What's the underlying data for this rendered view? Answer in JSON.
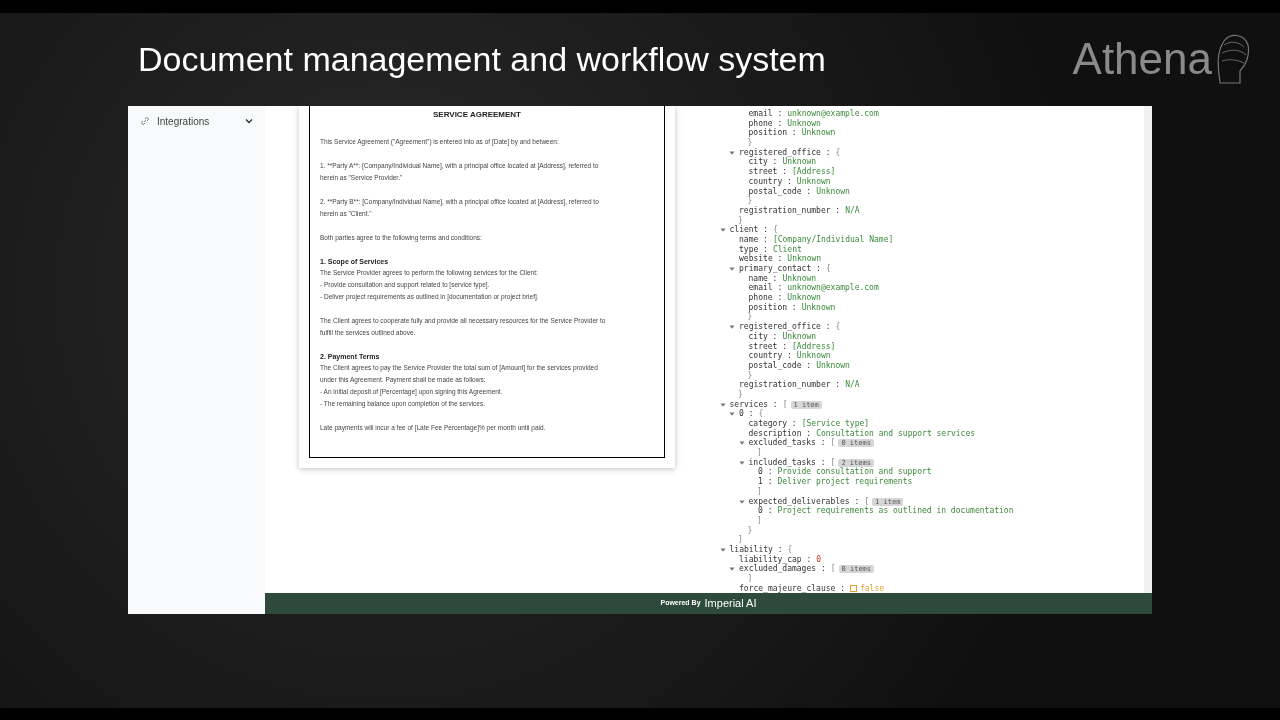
{
  "slide": {
    "title": "Document management and workflow system",
    "brand": "Athena"
  },
  "sidebar": {
    "items": [
      {
        "label": "Integrations",
        "expanded": false
      }
    ]
  },
  "document": {
    "title": "SERVICE AGREEMENT",
    "paragraphs": [
      {
        "lines": [
          "This Service Agreement (\"Agreement\") is entered into as of [Date] by and between:"
        ]
      },
      {
        "lines": [
          "1. **Party A**: [Company/Individual Name], with a principal office located at [Address], referred to",
          "herein as \"Service Provider.\""
        ]
      },
      {
        "lines": [
          "2. **Party B**: [Company/Individual Name], with a principal office located at [Address], referred to",
          "herein as \"Client.\""
        ]
      },
      {
        "lines": [
          "Both parties agree to the following terms and conditions:"
        ]
      },
      {
        "heading": "1. Scope of Services",
        "lines": [
          "The Service Provider agrees to perform the following services for the Client:",
          "- Provide consultation and support related to [service type].",
          "- Deliver project requirements as outlined in [documentation or project brief]."
        ]
      },
      {
        "lines": [
          "The Client agrees to cooperate fully and provide all necessary resources for the Service Provider to",
          "fulfill the services outlined above."
        ]
      },
      {
        "heading": "2. Payment Terms",
        "lines": [
          "The Client agrees to pay the Service Provider the total sum of [Amount] for the services provided",
          "under this Agreement. Payment shall be made as follows:",
          "- An initial deposit of [Percentage] upon signing this Agreement.",
          "- The remaining balance upon completion of the services."
        ]
      },
      {
        "lines": [
          "Late payments will incur a fee of [Late Fee Percentage]% per month until paid."
        ]
      }
    ]
  },
  "tree": [
    {
      "kind": "object",
      "close": "}",
      "children": [
        {
          "kind": "object",
          "close": "}",
          "children": [
            {
              "kind": "string",
              "key": "email :",
              "value": "unknown@example.com"
            },
            {
              "kind": "string",
              "key": "phone :",
              "value": "Unknown"
            },
            {
              "kind": "string",
              "key": "position :",
              "value": "Unknown"
            }
          ]
        },
        {
          "kind": "object",
          "key": "registered_office :",
          "open": "{",
          "close": "}",
          "expanded": true,
          "children": [
            {
              "kind": "string",
              "key": "city :",
              "value": "Unknown"
            },
            {
              "kind": "string",
              "key": "street :",
              "value": "[Address]"
            },
            {
              "kind": "string",
              "key": "country :",
              "value": "Unknown"
            },
            {
              "kind": "string",
              "key": "postal_code :",
              "value": "Unknown"
            }
          ]
        },
        {
          "kind": "string",
          "key": "registration_number :",
          "value": "N/A"
        }
      ]
    },
    {
      "kind": "object",
      "key": "client :",
      "open": "{",
      "close": "}",
      "expanded": true,
      "children": [
        {
          "kind": "string",
          "key": "name :",
          "value": "[Company/Individual Name]"
        },
        {
          "kind": "string",
          "key": "type :",
          "value": "Client"
        },
        {
          "kind": "string",
          "key": "website :",
          "value": "Unknown"
        },
        {
          "kind": "object",
          "key": "primary_contact :",
          "open": "{",
          "close": "}",
          "expanded": true,
          "children": [
            {
              "kind": "string",
              "key": "name :",
              "value": "Unknown"
            },
            {
              "kind": "string",
              "key": "email :",
              "value": "unknown@example.com"
            },
            {
              "kind": "string",
              "key": "phone :",
              "value": "Unknown"
            },
            {
              "kind": "string",
              "key": "position :",
              "value": "Unknown"
            }
          ]
        },
        {
          "kind": "object",
          "key": "registered_office :",
          "open": "{",
          "close": "}",
          "expanded": true,
          "children": [
            {
              "kind": "string",
              "key": "city :",
              "value": "Unknown"
            },
            {
              "kind": "string",
              "key": "street :",
              "value": "[Address]"
            },
            {
              "kind": "string",
              "key": "country :",
              "value": "Unknown"
            },
            {
              "kind": "string",
              "key": "postal_code :",
              "value": "Unknown"
            }
          ]
        },
        {
          "kind": "string",
          "key": "registration_number :",
          "value": "N/A"
        }
      ]
    },
    {
      "kind": "object",
      "key": "services :",
      "open": "[",
      "count": "1 item",
      "expanded": true,
      "close": "]",
      "children": [
        {
          "kind": "object",
          "key": "0 :",
          "open": "{",
          "close": "}",
          "expanded": true,
          "children": [
            {
              "kind": "string",
              "key": "category :",
              "value": "[Service type]"
            },
            {
              "kind": "string",
              "key": "description :",
              "value": "Consultation and support services"
            },
            {
              "kind": "object",
              "key": "excluded_tasks :",
              "open": "[",
              "count": "0 items",
              "close": "]",
              "expanded": true
            },
            {
              "kind": "object",
              "key": "included_tasks :",
              "open": "[",
              "count": "2 items",
              "close": "]",
              "expanded": true,
              "children": [
                {
                  "kind": "string",
                  "key": "0 :",
                  "value": "Provide consultation and support"
                },
                {
                  "kind": "string",
                  "key": "1 :",
                  "value": "Deliver project requirements"
                }
              ]
            },
            {
              "kind": "object",
              "key": "expected_deliverables :",
              "open": "[",
              "count": "1 item",
              "close": "]",
              "expanded": true,
              "children": [
                {
                  "kind": "string",
                  "key": "0 :",
                  "value": "Project requirements as outlined in documentation"
                }
              ]
            }
          ]
        }
      ]
    },
    {
      "kind": "object",
      "key": "liability :",
      "open": "{",
      "expanded": true,
      "children": [
        {
          "kind": "number",
          "key": "liability_cap :",
          "value": "0"
        },
        {
          "kind": "object",
          "key": "excluded_damages :",
          "open": "[",
          "count": "0 items",
          "close": "]",
          "expanded": true
        },
        {
          "kind": "boolean",
          "key": "force_majeure_clause :",
          "value": "false",
          "checked": false
        }
      ]
    }
  ],
  "footer": {
    "prefix": "Powered By",
    "brand": "Imperial AI"
  }
}
